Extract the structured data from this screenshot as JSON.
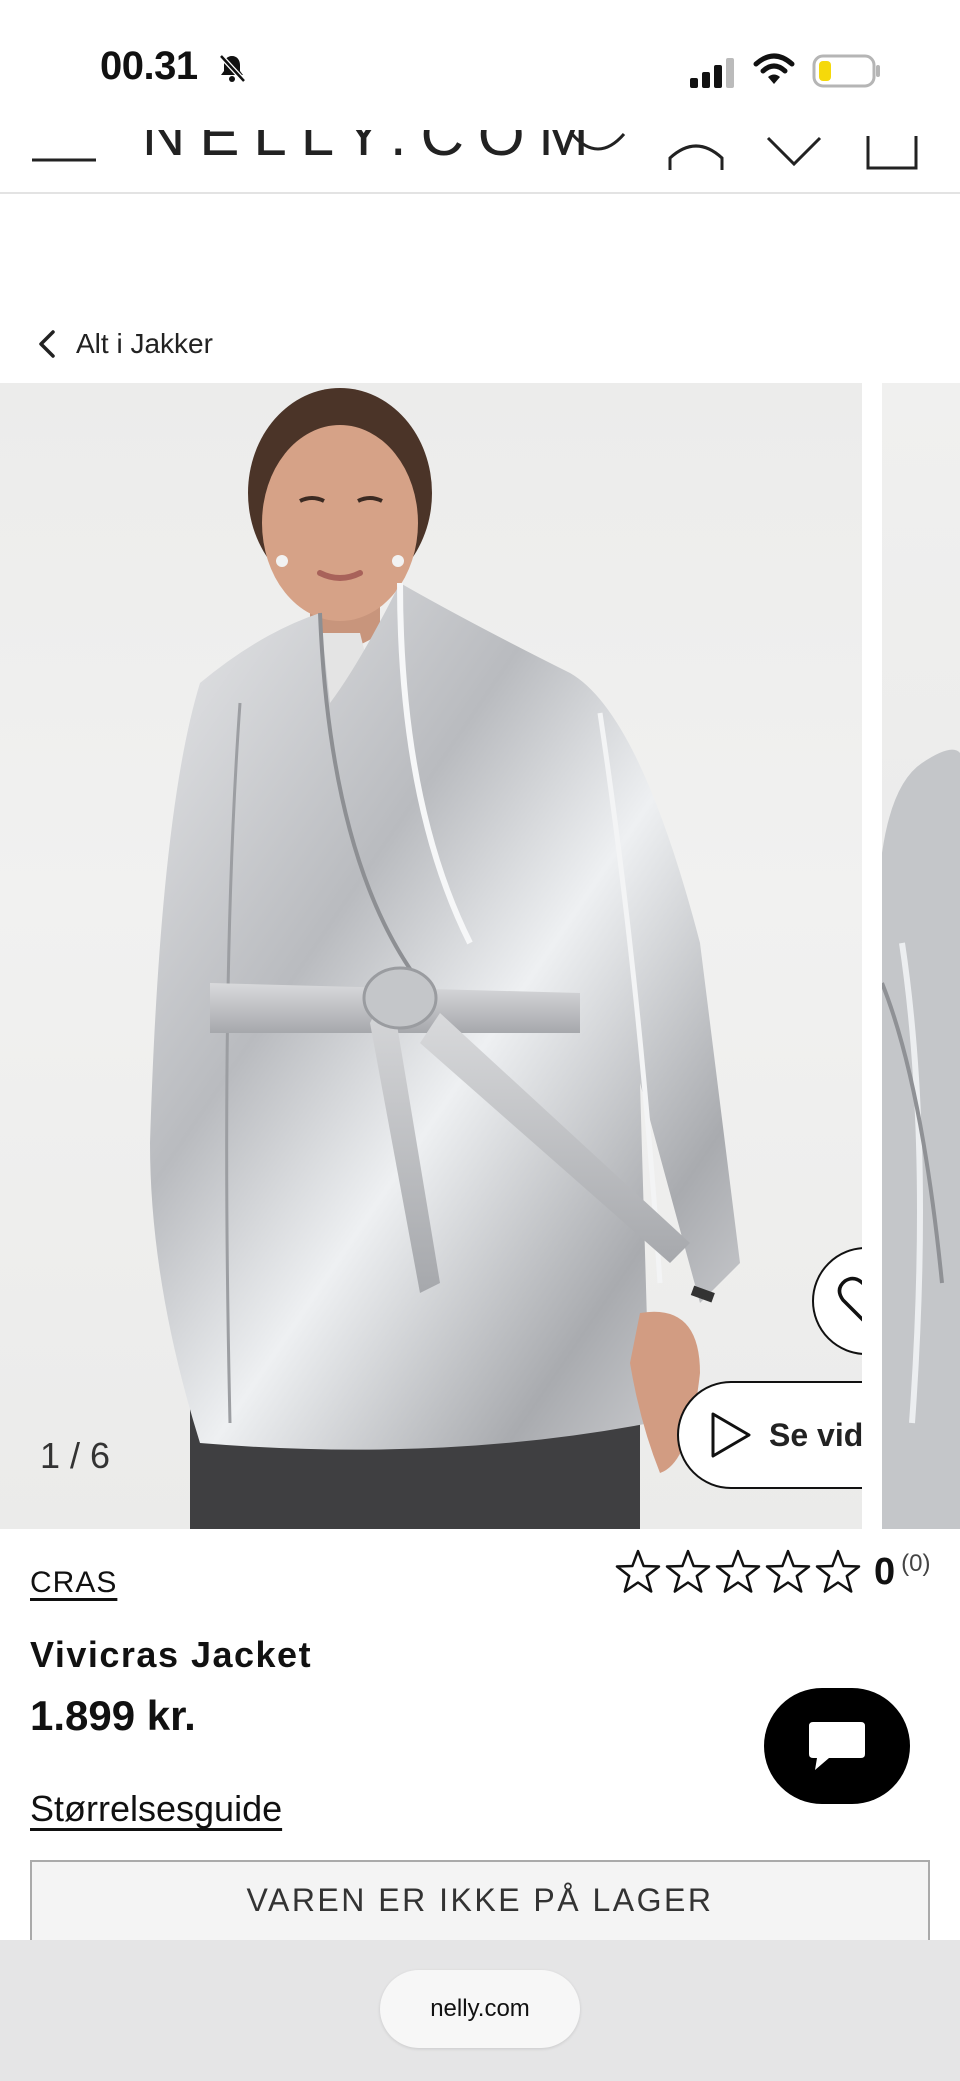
{
  "status_bar": {
    "time": "00.31",
    "icons": [
      "bell-slash-icon",
      "signal-icon",
      "wifi-icon",
      "battery-icon"
    ],
    "battery_color": "#f5d90a"
  },
  "header": {
    "logo": "NELLY.COM",
    "icons": [
      "menu-icon",
      "search-icon",
      "account-icon",
      "favorites-icon",
      "bag-icon"
    ]
  },
  "breadcrumb": {
    "back_icon": "chevron-left-icon",
    "label": "Alt i Jakker"
  },
  "gallery": {
    "counter": "1 / 6",
    "current_slide": 1,
    "total_slides": 6,
    "favorite_icon": "heart-icon",
    "video_icon": "play-icon",
    "video_label": "Se video"
  },
  "product": {
    "brand": "CRAS",
    "name": "Vivicras Jacket",
    "price": "1.899 kr.",
    "rating_value": "0",
    "rating_count": "(0)",
    "rating_stars": 0,
    "max_stars": 5,
    "size_guide": "Størrelsesguide",
    "stock_button": "VAREN ER IKKE PÅ LAGER"
  },
  "chat": {
    "icon": "chat-bubble-icon"
  },
  "browser": {
    "url": "nelly.com"
  }
}
